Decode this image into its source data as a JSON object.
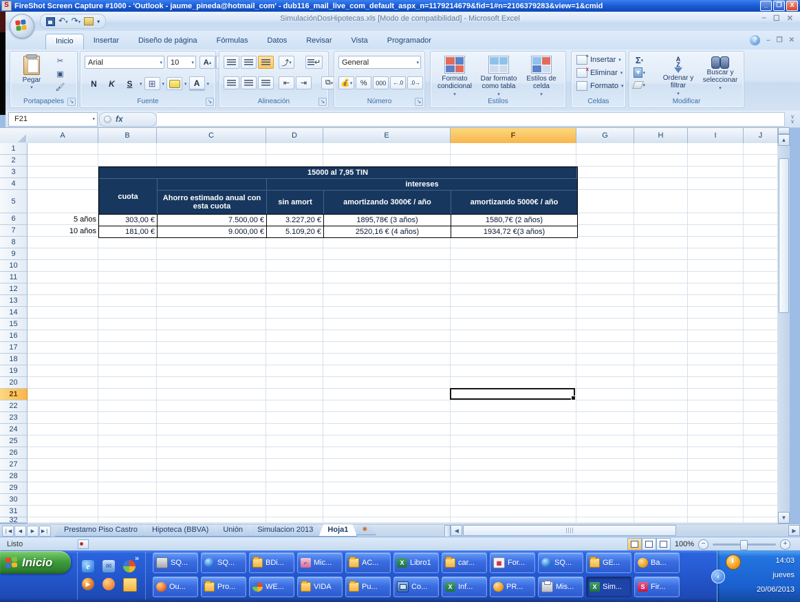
{
  "fireshot_bar": {
    "app_letter": "S",
    "title": "FireShot Screen Capture #1000 - 'Outlook - jaume_pineda@hotmail_com' - dub116_mail_live_com_default_aspx_n=1179214679&fid=1#n=2106379283&view=1&cmid"
  },
  "excel": {
    "title": "SimulaciónDosHipotecas.xls  [Modo de compatibilidad] - Microsoft Excel",
    "ribbon_tabs": [
      "Inicio",
      "Insertar",
      "Diseño de página",
      "Fórmulas",
      "Datos",
      "Revisar",
      "Vista",
      "Programador"
    ],
    "active_tab": "Inicio",
    "ribbon": {
      "portapapeles": {
        "label": "Portapapeles",
        "paste": "Pegar"
      },
      "fuente": {
        "label": "Fuente",
        "font_name": "Arial",
        "font_size": "10",
        "bold": "N",
        "italic": "K",
        "underline": "S"
      },
      "alineacion": {
        "label": "Alineación"
      },
      "numero": {
        "label": "Número",
        "format": "General",
        "percent": "%",
        "thousands": "000"
      },
      "estilos": {
        "label": "Estilos",
        "conditional": "Formato condicional",
        "as_table": "Dar formato como tabla",
        "cell_styles": "Estilos de celda"
      },
      "celdas": {
        "label": "Celdas",
        "insert": "Insertar",
        "delete": "Eliminar",
        "format": "Formato"
      },
      "modificar": {
        "label": "Modificar",
        "sum": "Σ",
        "sort": "Ordenar y filtrar",
        "find": "Buscar y seleccionar"
      }
    },
    "formula_bar": {
      "name_box": "F21",
      "fx": "fx"
    },
    "grid": {
      "columns": [
        "A",
        "B",
        "C",
        "D",
        "E",
        "F",
        "G",
        "H",
        "I",
        "J"
      ],
      "selected_column": "F",
      "selected_row": 21,
      "selected_cell": "F21",
      "row_count": 32
    },
    "table": {
      "title": "15000 al 7,95 TIN",
      "intereses": "intereses",
      "cuota": "cuota",
      "ahorro": "Ahorro estimado anual con esta cuota",
      "sin_amort": "sin amort",
      "amort3000": "amortizando 3000€ / año",
      "amort5000": "amortizando 5000€ / año",
      "rows": [
        {
          "periodo": "5 años",
          "cuota": "303,00 €",
          "ahorro": "7.500,00 €",
          "sin_amort": "3.227,20 €",
          "amort3000": "1895,78€ (3 años)",
          "amort5000": "1580,7€ (2 años)"
        },
        {
          "periodo": "10 años",
          "cuota": "181,00 €",
          "ahorro": "9.000,00 €",
          "sin_amort": "5.109,20 €",
          "amort3000": "2520,16 € (4 años)",
          "amort5000": "1934,72 €(3 años)"
        }
      ]
    },
    "sheet_tabs": [
      "Prestamo Piso Castro",
      "Hipoteca (BBVA)",
      "Unión",
      "Simulacion 2013",
      "Hoja1"
    ],
    "active_sheet": "Hoja1",
    "status_bar": {
      "ready": "Listo",
      "zoom": "100%"
    }
  },
  "taskbar": {
    "start_label": "Inicio",
    "quick_launch_icons": [
      "ie-icon",
      "outlook-express-icon",
      "msn-icon",
      "media-player-icon",
      "firefox-icon",
      "folder-icon"
    ],
    "buttons_row1": [
      {
        "label": "SQ...",
        "icon": "app-icon"
      },
      {
        "label": "SQ...",
        "icon": "globe-icon"
      },
      {
        "label": "BDi...",
        "icon": "folder-icon"
      },
      {
        "label": "Mic...",
        "icon": "key-icon"
      },
      {
        "label": "AC...",
        "icon": "folder-icon"
      },
      {
        "label": "Libro1",
        "icon": "excel-icon"
      },
      {
        "label": "car...",
        "icon": "folder-icon"
      },
      {
        "label": "For...",
        "icon": "form-icon"
      },
      {
        "label": "SQ...",
        "icon": "globe-icon"
      },
      {
        "label": "GE...",
        "icon": "folder-icon"
      },
      {
        "label": "Ba...",
        "icon": "clock-orange-icon"
      }
    ],
    "buttons_row2": [
      {
        "label": "Ou...",
        "icon": "firefox-icon"
      },
      {
        "label": "Pro...",
        "icon": "folder-icon"
      },
      {
        "label": "WE...",
        "icon": "pinwheel-icon"
      },
      {
        "label": "VIDA",
        "icon": "folder-icon"
      },
      {
        "label": "Pu...",
        "icon": "folder-icon"
      },
      {
        "label": "Co...",
        "icon": "computer-icon"
      },
      {
        "label": "Inf...",
        "icon": "excel-icon"
      },
      {
        "label": "PR...",
        "icon": "orange-ball-icon"
      },
      {
        "label": "Mis...",
        "icon": "printer-icon"
      },
      {
        "label": "Sim...",
        "icon": "excel-icon",
        "active": true
      },
      {
        "label": "Fir...",
        "icon": "fireshot-icon"
      }
    ],
    "clock": {
      "time": "14:03",
      "day": "jueves",
      "date": "20/06/2013"
    }
  },
  "colors": {
    "header_navy": "#17375e",
    "selection_orange": "#f9b54c",
    "taskbar_blue": "#2457cd",
    "start_green": "#3f9e3c"
  }
}
